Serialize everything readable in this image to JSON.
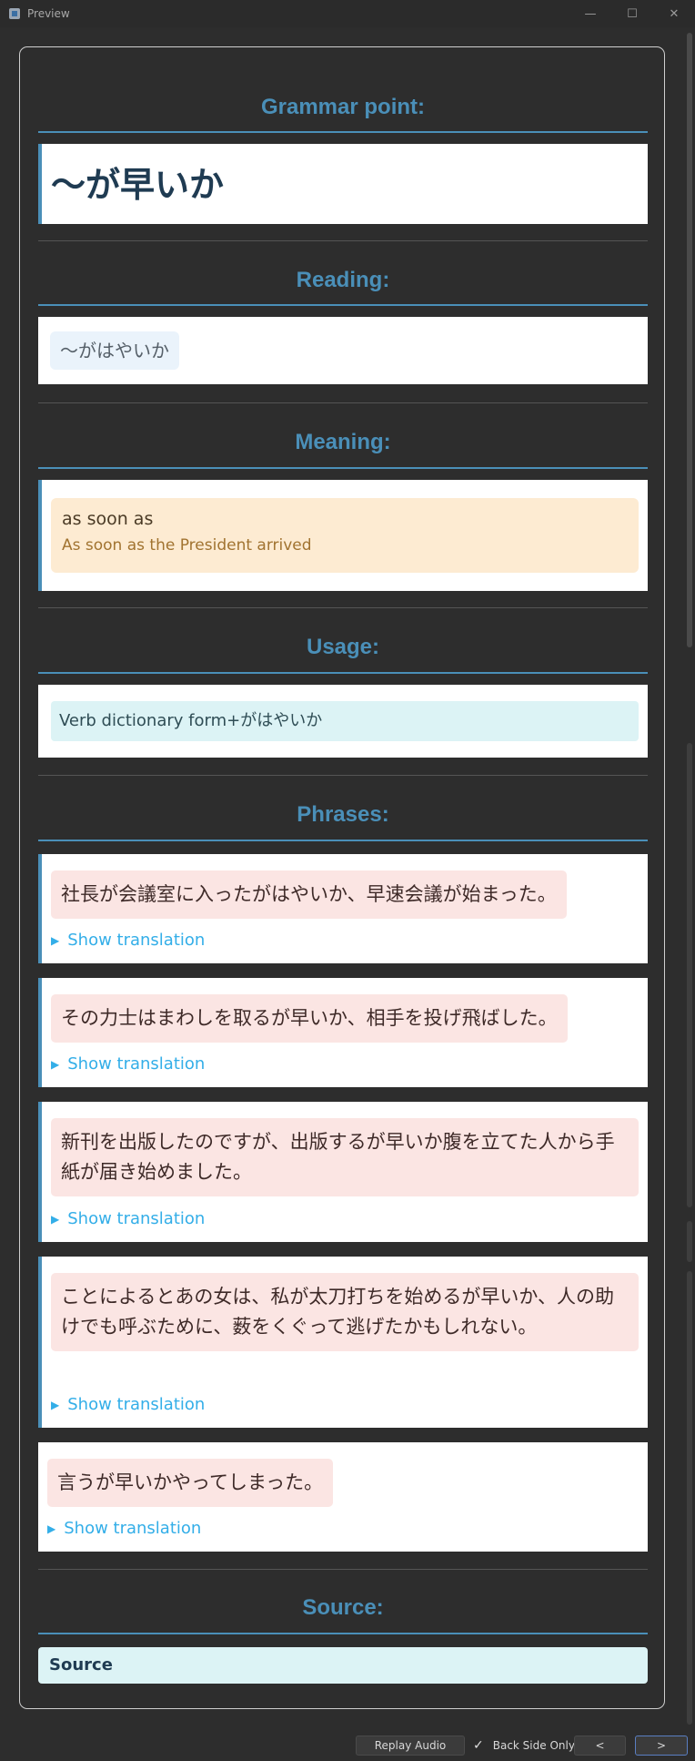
{
  "window": {
    "title": "Preview",
    "minimize": "—",
    "maximize": "☐",
    "close": "✕"
  },
  "grammar": {
    "heading": "Grammar point:",
    "value": "〜が早いか"
  },
  "reading": {
    "heading": "Reading:",
    "value": "〜がはやいか"
  },
  "meaning": {
    "heading": "Meaning:",
    "main": "as soon as",
    "example": "As soon as the President arrived"
  },
  "usage": {
    "heading": "Usage:",
    "value": "Verb dictionary form+がはやいか"
  },
  "phrases": {
    "heading": "Phrases:",
    "show_label": "Show translation",
    "items": [
      "社長が会議室に入ったがはやいか、早速会議が始まった。",
      "その力士はまわしを取るが早いか、相手を投げ飛ばした。",
      "新刊を出版したのですが、出版するが早いか腹を立てた人から手紙が届き始めました。",
      "ことによるとあの女は、私が太刀打ちを始めるが早いか、人の助けでも呼ぶために、薮をくぐって逃げたかもしれない。",
      "言うが早いかやってしまった。"
    ]
  },
  "source": {
    "heading": "Source:",
    "value": "Source"
  },
  "bottom_bar": {
    "replay_audio": "Replay Audio",
    "back_side_only": "Back Side Only",
    "prev": "<",
    "next": ">"
  },
  "colors": {
    "accent": "#4a8fb8",
    "link": "#33aee8",
    "meaning_bg": "#fdebd2",
    "usage_bg": "#dcf3f5",
    "phrase_bg": "#fbe5e3"
  }
}
